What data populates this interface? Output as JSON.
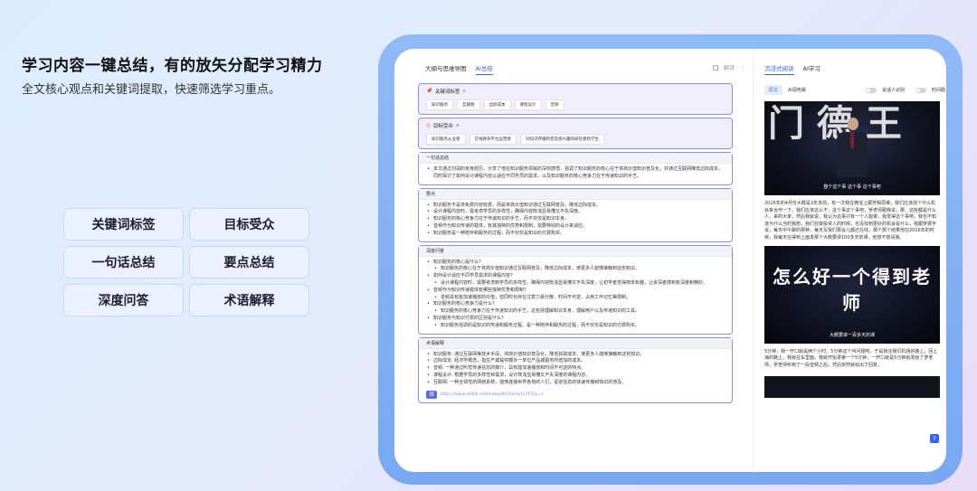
{
  "hero": {
    "title": "学习内容一键总结，有的放矢分配学习精力",
    "subtitle": "全文核心观点和关键词提取，快速筛选学习重点。"
  },
  "features": [
    "关键词标签",
    "目标受众",
    "一句话总结",
    "要点总结",
    "深度问答",
    "术语解释"
  ],
  "app": {
    "left_tabs": [
      "大纲与思维导图",
      "AI总结"
    ],
    "left_active_tab": "AI总结",
    "left_tool_label": "翻译",
    "keyword_card": {
      "title": "关键词标签",
      "tags": [
        "知识服务",
        "互联网",
        "边际成本",
        "课程设计",
        "音频"
      ]
    },
    "audience_card": {
      "title": "目标受众",
      "tags": [
        "知识服务从业者",
        "在线教育平台运营者",
        "对知识传播和普及感兴趣的研究者和学生"
      ]
    },
    "summary_card": {
      "title": "一句话总结",
      "bullets": [
        "本文通过刘润的亲身经历，分享了他在知识服务领域的深刻感悟，强调了知识服务的核心在于将高价值知识普及化，并通过互联网降低边际成本，同时探讨了如何设计课程内容以适应不同学员的需求，以及知识服务的核心竞争力在于传递知识的手艺。"
      ]
    },
    "points_card": {
      "title": "要点",
      "bullets": [
        "知识服务不是将免费内容收费，而是将高价值知识通过互联网普及，降低边际成本。",
        "设计课程内容时，需考虑学员的多样性，确保内容既浅显易懂又不失深度。",
        "知识服务的核心竞争力在于传递知识的手艺，而不仅仅是知识本身。",
        "音频作为知识传递的载体，有其独特的优势和限制，需要特别的设计来适应。",
        "知识服务是一种陪伴和服务的过程，而不仅仅是知识的付费购买。"
      ]
    },
    "qa_card": {
      "title": "深度问答",
      "items": [
        {
          "q": "知识服务的核心是什么?",
          "a": "知识服务的核心在于将高价值知识通过互联网普及，降低边际成本，使更多人能够接触到这些知识。"
        },
        {
          "q": "如何设计适应不同学员需求的课程内容?",
          "a": "设计课程内容时，需要考虑到学员的多样性，确保内容既浅显易懂又不失深度，让初学者觉得简单有趣，让资深者感到有深度和精妙。"
        },
        {
          "q": "音频作为知识传递载体有哪些独特优势和限制?",
          "a": "音频具有能加速播放的价值，但同时也存在注意力易分散，时间不可逆，占用工作记忆等限制。"
        },
        {
          "q": "知识服务的核心竞争力是什么?",
          "a": "知识服务的核心竞争力在于传递知识的手艺，这包括理解知识本身，理解用户以及传递知识的工具。"
        },
        {
          "q": "知识服务与知识付费的区别是什么?",
          "a": "知识服务强调的是知识的传递和服务过程，是一种陪伴和服务的过程，而不仅仅是知识的付费购买。"
        }
      ]
    },
    "terms_card": {
      "title": "术语解释",
      "bullets": [
        "知识服务: 通过互联网等技术手段，将高价值知识普及化，降低获取成本，使更多人能够接触到这些知识。",
        "边际成本: 经济学概念，指生产或提供额外一单位产品或服务所增加的成本。",
        "音频: 一种通过听觉传递信息的媒介，具有能加速播放和时间不可逆的特点。",
        "课程设计: 根据学员的多样性和需求，设计既浅显易懂又不失深度的课程内容。",
        "互联网: 一种全球性的网络系统，能够连接世界各地的人们，促进信息的快速传播和知识的普及。"
      ]
    },
    "source_link": "https://www.bilibili.com/video/BV1Hx4y1x7F5?p=1",
    "chat_icon": "chat-icon",
    "right_tabs": [
      "沉浸式阅读",
      "AI学习"
    ],
    "right_active_tab": "沉浸式阅读",
    "right_controls": {
      "mode_active": "原文",
      "mode_other": "AI润色版",
      "toggle1": "说话人识别",
      "toggle2": "时间戳"
    },
    "video1_caption": "整个这个事 这个事 这个事吧",
    "video1_big_text": "门 德 王",
    "paragraph1": "2016年的4月份大概是3年多前，有一次我在微信上跟罗辑思维，我们应该找个什么机会来合作一下，我们应该这么干，这个事这个事吧，罗老师跟我说，那，这些都是什么人，来的大家，然后我就说，我认为这事只有一个人能做，我觉得这个事吧，我也不知道为什么当时我想，我们在做投资人的时候，也没找到更好的机会是什么，我跟罗振宇说，每天中午聊的那种，每天写我们那会儿都还在线，那个那个结果他在2016年的时候，我每天在得到上面发那个大概要讲100多天的课，他想不想请我。",
    "video2_caption": "大概要讲一百多天的课",
    "video2_title": "怎么好一个得到老师",
    "paragraph2": "5分钟，我一开口就是两个小时，5分钟这个叫问题吧，于是我在我们机场的路上，回上海的路上，我就在车里面，我就开始录第一个5分钟，一开口就是5分钟就发给了罗老师，罗老师听到了一段音频之后，然后突然就给出了回复。"
  }
}
